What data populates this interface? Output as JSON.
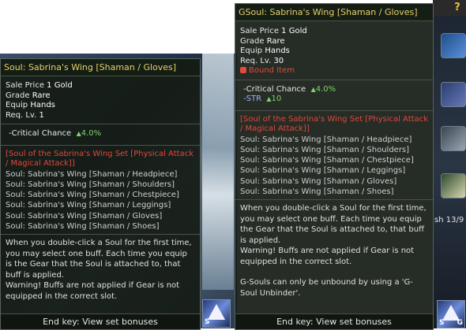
{
  "left_tooltip": {
    "title": "Soul: Sabrina's Wing [Shaman / Gloves]",
    "info": [
      {
        "label": "Sale Price",
        "value": "1 Gold"
      },
      {
        "label": "Grade",
        "value": "Rare"
      },
      {
        "label": "Equip",
        "value": "Hands"
      },
      {
        "label": "Req. Lv.",
        "value": "1"
      }
    ],
    "stats": [
      {
        "name": "-Critical Chance",
        "value": "4.0%"
      }
    ],
    "set_name": "[Soul of the Sabrina's Wing Set [Physical Attack / Magical Attack]]",
    "set_items": [
      "Soul: Sabrina's Wing [Shaman / Headpiece]",
      "Soul: Sabrina's Wing [Shaman / Shoulders]",
      "Soul: Sabrina's Wing [Shaman / Chestpiece]",
      "Soul: Sabrina's Wing [Shaman / Leggings]",
      "Soul: Sabrina's Wing [Shaman / Gloves]",
      "Soul: Sabrina's Wing [Shaman / Shoes]"
    ],
    "desc1": "When you double-click a Soul for the first time, you may select one buff. Each time you equip is the Gear that the Soul is attached to, that buff is applied.",
    "desc2": "Warning! Buffs are not applied if Gear is not equipped in the correct slot.",
    "footer": "End key: View set bonuses"
  },
  "right_tooltip": {
    "title": "GSoul: Sabrina's Wing [Shaman / Gloves]",
    "info": [
      {
        "label": "Sale Price",
        "value": "1 Gold"
      },
      {
        "label": "Grade",
        "value": "Rare"
      },
      {
        "label": "Equip",
        "value": "Hands"
      },
      {
        "label": "Req. Lv.",
        "value": "30"
      }
    ],
    "bound": "Bound Item",
    "stats": [
      {
        "name": "-Critical Chance",
        "value": "4.0%"
      },
      {
        "name": "-STR",
        "value": "10"
      }
    ],
    "set_name": "[Soul of the Sabrina's Wing Set [Physical Attack / Magical Attack]]",
    "set_items": [
      "Soul: Sabrina's Wing [Shaman / Headpiece]",
      "Soul: Sabrina's Wing [Shaman / Shoulders]",
      "Soul: Sabrina's Wing [Shaman / Chestpiece]",
      "Soul: Sabrina's Wing [Shaman / Leggings]",
      "Soul: Sabrina's Wing [Shaman / Gloves]",
      "Soul: Sabrina's Wing [Shaman / Shoes]"
    ],
    "desc1": "When you double-click a Soul for the first time, you may select one buff. Each time you equip the Gear that the Soul is attached to, that buff is applied.",
    "desc2": "Warning! Buffs are not applied if Gear is not equipped in the correct slot.",
    "desc3": "G-Souls can only be unbound by using a 'G-Soul Unbinder'.",
    "footer": "End key: View set bonuses"
  },
  "side": {
    "help_label": "?",
    "partial_text": "sh 13/9",
    "icon_left": {
      "s": "S"
    },
    "icon_right": {
      "s": "S",
      "g": "G"
    }
  }
}
